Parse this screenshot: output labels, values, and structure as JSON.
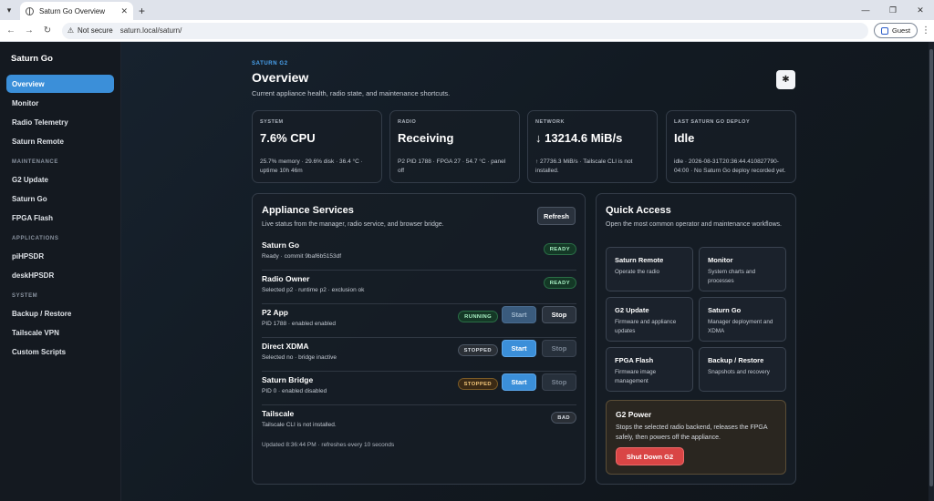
{
  "browser": {
    "tab_title": "Saturn Go Overview",
    "new_tab": "+",
    "security": "Not secure",
    "url": "saturn.local/saturn/",
    "profile": "Guest",
    "win_min": "—",
    "win_max": "❐",
    "win_close": "✕"
  },
  "sidebar": {
    "brand": "Saturn Go",
    "items_top": [
      "Overview",
      "Monitor",
      "Radio Telemetry",
      "Saturn Remote"
    ],
    "sec_maintenance": "MAINTENANCE",
    "items_maint": [
      "G2 Update",
      "Saturn Go",
      "FPGA Flash"
    ],
    "sec_applications": "APPLICATIONS",
    "items_apps": [
      "piHPSDR",
      "deskHPSDR"
    ],
    "sec_system": "SYSTEM",
    "items_system": [
      "Backup / Restore",
      "Tailscale VPN",
      "Custom Scripts"
    ]
  },
  "header": {
    "eyebrow": "SATURN G2",
    "title": "Overview",
    "subtitle": "Current appliance health, radio state, and maintenance shortcuts."
  },
  "stats": [
    {
      "label": "SYSTEM",
      "value": "7.6% CPU",
      "detail": "25.7% memory · 29.6% disk · 36.4 °C · uptime 10h 46m"
    },
    {
      "label": "RADIO",
      "value": "Receiving",
      "detail": "P2 PID 1788 · FPGA 27 · 54.7 °C · panel off"
    },
    {
      "label": "NETWORK",
      "value": "↓ 13214.6 MiB/s",
      "detail": "↑ 27736.3 MiB/s · Tailscale CLI is not installed."
    },
    {
      "label": "LAST SATURN GO DEPLOY",
      "value": "Idle",
      "detail": "idle · 2026-08-31T20:36:44.410827790-04:00 · No Saturn Go deploy recorded yet."
    }
  ],
  "services": {
    "title": "Appliance Services",
    "subtitle": "Live status from the manager, radio service, and browser bridge.",
    "refresh": "Refresh",
    "rows": [
      {
        "name": "Saturn Go",
        "desc": "Ready · commit 9baf6b5153df",
        "badge": "READY"
      },
      {
        "name": "Radio Owner",
        "desc": "Selected p2 · runtime p2 · exclusion ok",
        "badge": "READY"
      },
      {
        "name": "P2 App",
        "desc": "PID 1788 · enabled enabled",
        "badge": "RUNNING",
        "start": "Start",
        "stop": "Stop"
      },
      {
        "name": "Direct XDMA",
        "desc": "Selected no · bridge inactive",
        "badge": "STOPPED",
        "start": "Start",
        "stop": "Stop"
      },
      {
        "name": "Saturn Bridge",
        "desc": "PID 0 · enabled disabled",
        "badge": "STOPPED",
        "start": "Start",
        "stop": "Stop"
      },
      {
        "name": "Tailscale",
        "desc": "Tailscale CLI is not installed.",
        "badge": "BAD"
      }
    ],
    "updated": "Updated 8:36:44 PM · refreshes every 10 seconds"
  },
  "quick": {
    "title": "Quick Access",
    "subtitle": "Open the most common operator and maintenance workflows.",
    "tiles": [
      {
        "title": "Saturn Remote",
        "desc": "Operate the radio"
      },
      {
        "title": "Monitor",
        "desc": "System charts and processes"
      },
      {
        "title": "G2 Update",
        "desc": "Firmware and appliance updates"
      },
      {
        "title": "Saturn Go",
        "desc": "Manager deployment and XDMA"
      },
      {
        "title": "FPGA Flash",
        "desc": "Firmware image management"
      },
      {
        "title": "Backup / Restore",
        "desc": "Snapshots and recovery"
      }
    ],
    "power": {
      "title": "G2 Power",
      "desc": "Stops the selected radio backend, releases the FPGA safely, then powers off the appliance.",
      "button": "Shut Down G2"
    }
  },
  "colors": {
    "accent": "#3b8fd9",
    "danger": "#d94545",
    "ready": "#a8f0c4",
    "stopped": "#f4c77a"
  }
}
